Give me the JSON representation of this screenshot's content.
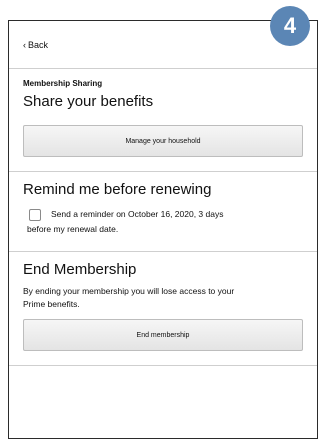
{
  "step_badge": "4",
  "header": {
    "back_label": "Back"
  },
  "membership_sharing": {
    "subtitle": "Membership Sharing",
    "title": "Share your benefits",
    "button_label": "Manage your household"
  },
  "reminder": {
    "title": "Remind me before renewing",
    "checkbox_checked": false,
    "text_line1": "Send a reminder on October 16, 2020, 3 days",
    "text_line2": "before my renewal date."
  },
  "end_membership": {
    "title": "End Membership",
    "description_line1": "By ending your membership you will lose access to your",
    "description_line2": "Prime benefits.",
    "button_label": "End membership"
  },
  "colors": {
    "badge": "#5b86b5",
    "border": "#2b2b2b"
  }
}
